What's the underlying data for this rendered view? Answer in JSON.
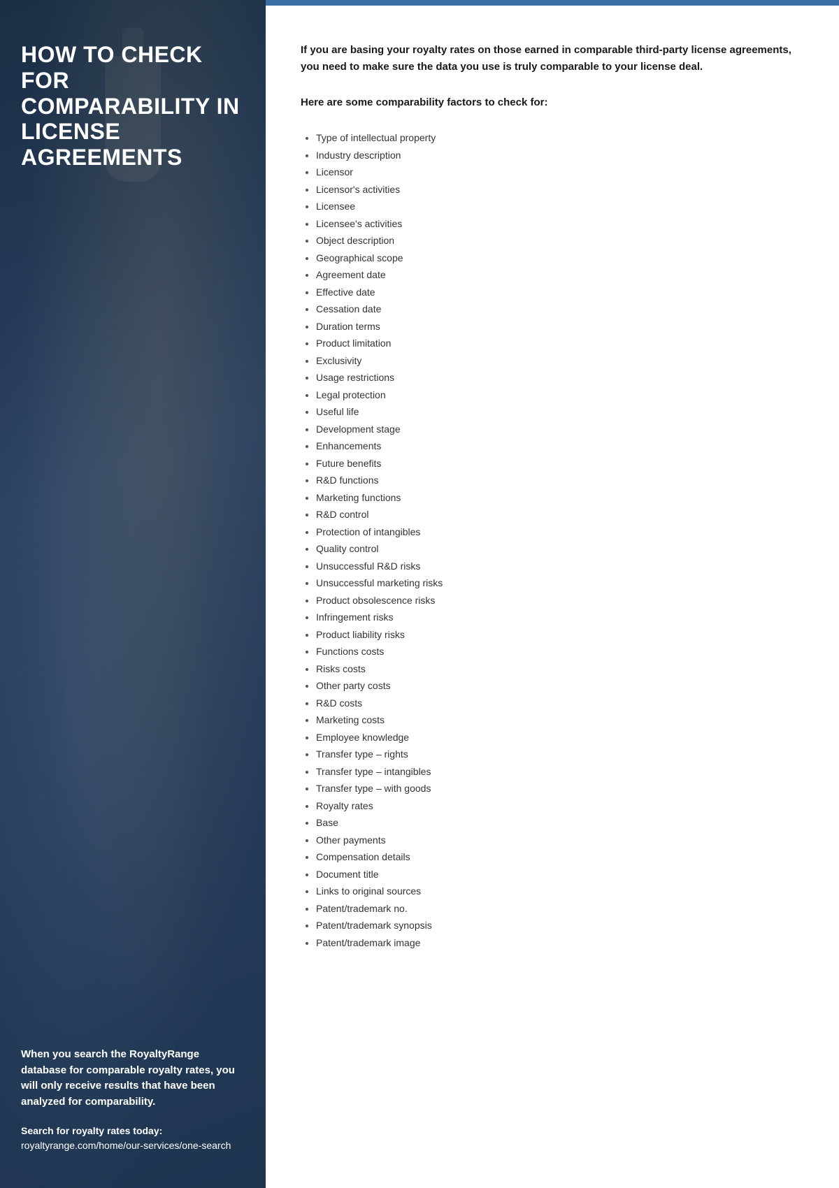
{
  "left": {
    "title": "HOW TO CHECK FOR COMPARABILITY IN LICENSE AGREEMENTS",
    "bottom_text": "When you search the RoyaltyRange database for comparable royalty rates, you will only receive results that have been analyzed for comparability.",
    "link_label": "Search for royalty rates today:",
    "link_url": "royaltyrange.com/home/our-services/one-search"
  },
  "right": {
    "intro_text": "If you are basing your royalty rates on those earned in comparable third-party license agreements, you need to make sure the data you use is truly comparable to your license deal.",
    "section_heading": "Here are some comparability factors to check for:",
    "list_items": [
      "Type of intellectual property",
      "Industry description",
      "Licensor",
      "Licensor's activities",
      "Licensee",
      "Licensee's activities",
      "Object description",
      "Geographical scope",
      "Agreement date",
      "Effective date",
      "Cessation date",
      "Duration terms",
      "Product limitation",
      "Exclusivity",
      "Usage restrictions",
      "Legal protection",
      "Useful life",
      "Development stage",
      "Enhancements",
      "Future benefits",
      "R&D functions",
      "Marketing functions",
      "R&D control",
      "Protection of intangibles",
      "Quality control",
      "Unsuccessful R&D risks",
      "Unsuccessful marketing risks",
      "Product obsolescence risks",
      "Infringement risks",
      "Product liability risks",
      "Functions costs",
      "Risks costs",
      "Other party costs",
      "R&D costs",
      "Marketing costs",
      "Employee knowledge",
      "Transfer type – rights",
      "Transfer type – intangibles",
      "Transfer type – with goods",
      "Royalty rates",
      "Base",
      "Other payments",
      "Compensation details",
      "Document title",
      "Links to original sources",
      "Patent/trademark no.",
      "Patent/trademark synopsis",
      "Patent/trademark image"
    ]
  },
  "top_bar_color": "#3a6ea5"
}
